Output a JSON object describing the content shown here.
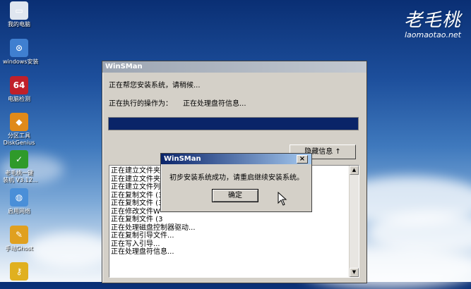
{
  "desktop": {
    "icons": [
      {
        "label": "我的电脑",
        "icon": "computer-icon",
        "glyph": "▭",
        "color": "#dfe6ef"
      },
      {
        "label": "windows安装",
        "icon": "windows-install-icon",
        "glyph": "⊙",
        "color": "#3f7fd0"
      },
      {
        "label": "电脑检测",
        "icon": "pc-check-icon",
        "glyph": "64",
        "color": "#c0202a"
      },
      {
        "label": "分区工具",
        "label2": "DiskGenius",
        "icon": "diskgenius-icon",
        "glyph": "◆",
        "color": "#e08a1a"
      },
      {
        "label": "老毛桃一键",
        "label2": "装机 V3.12...",
        "icon": "one-key-install-icon",
        "glyph": "✓",
        "color": "#2f9a2a"
      },
      {
        "label": "启用网络",
        "icon": "network-icon",
        "glyph": "◍",
        "color": "#4a8fd8"
      },
      {
        "label": "手动Ghost",
        "icon": "ghost-icon",
        "glyph": "✎",
        "color": "#e0a020"
      },
      {
        "label": "",
        "icon": "key-icon",
        "glyph": "⚷",
        "color": "#e0b020"
      }
    ],
    "logo_text": "老毛桃",
    "logo_url": "laomaotao.net"
  },
  "window": {
    "title": "WinSMan",
    "status_line": "正在帮您安装系统，请稍候...",
    "operation_label": "正在执行的操作为：",
    "operation_value": "正在处理盘符信息...",
    "progress_fraction": 1.0,
    "progress_color": "#0a2468",
    "hide_info_button": "隐藏信息 ↑",
    "log_lines": [
      "正在建立文件夹",
      "正在建立文件夹",
      "正在建立文件列",
      "正在复制文件 (3",
      "正在复制文件 (3",
      "正在修改文件W",
      "正在复制文件 (3",
      "正在处理磁盘控制器驱动...",
      "正在复制引导文件...",
      "正在写入引导...",
      "正在处理盘符信息..."
    ]
  },
  "dialog": {
    "title": "WinSMan",
    "message": "初步安装系统成功，请重启继续安装系统。",
    "ok_button": "确定"
  }
}
